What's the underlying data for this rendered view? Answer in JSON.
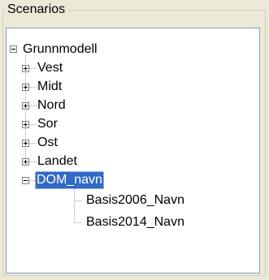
{
  "group": {
    "legend": "Scenarios"
  },
  "tree": {
    "root": {
      "label": "Grunnmodell",
      "expanded": true
    },
    "children": [
      {
        "label": "Vest",
        "expanded": false
      },
      {
        "label": "Midt",
        "expanded": false
      },
      {
        "label": "Nord",
        "expanded": false
      },
      {
        "label": "Sor",
        "expanded": false
      },
      {
        "label": "Ost",
        "expanded": false
      },
      {
        "label": "Landet",
        "expanded": false
      },
      {
        "label": "DOM_navn",
        "expanded": true,
        "selected": true,
        "children": [
          {
            "label": "Basis2006_Navn"
          },
          {
            "label": "Basis2014_Navn"
          }
        ]
      }
    ]
  },
  "colors": {
    "selection": "#316ac5",
    "tree_lines": "#a0a0a0"
  }
}
